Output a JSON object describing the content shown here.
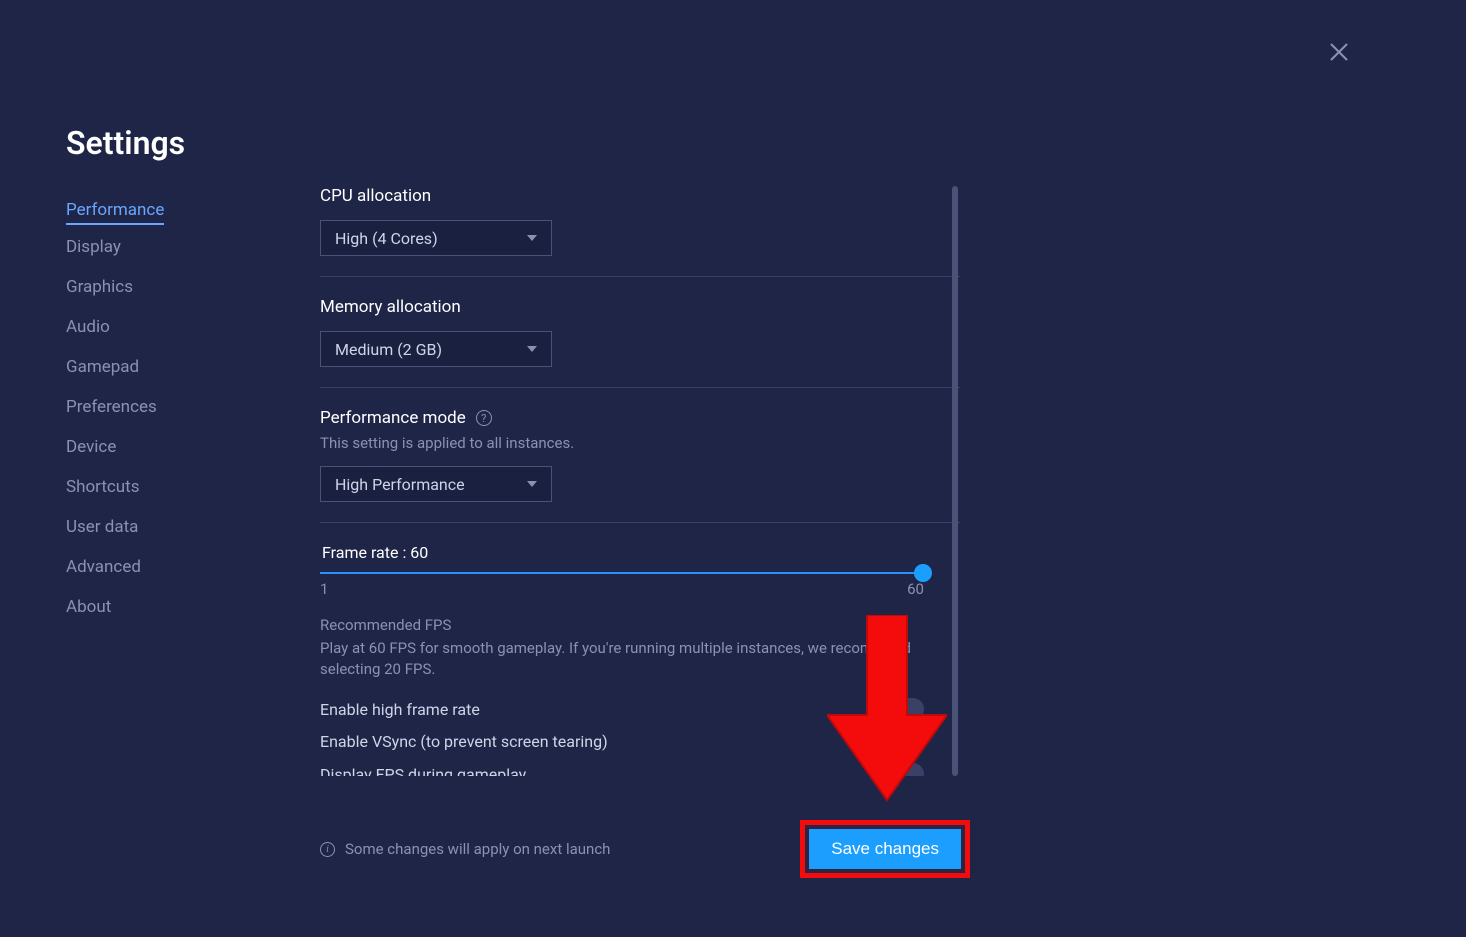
{
  "title": "Settings",
  "sidebar": {
    "items": [
      {
        "label": "Performance",
        "active": true
      },
      {
        "label": "Display"
      },
      {
        "label": "Graphics"
      },
      {
        "label": "Audio"
      },
      {
        "label": "Gamepad"
      },
      {
        "label": "Preferences"
      },
      {
        "label": "Device"
      },
      {
        "label": "Shortcuts"
      },
      {
        "label": "User data"
      },
      {
        "label": "Advanced"
      },
      {
        "label": "About"
      }
    ]
  },
  "sections": {
    "cpu": {
      "label": "CPU allocation",
      "value": "High (4 Cores)"
    },
    "memory": {
      "label": "Memory allocation",
      "value": "Medium (2 GB)"
    },
    "performance_mode": {
      "label": "Performance mode",
      "sublabel": "This setting is applied to all instances.",
      "value": "High Performance"
    },
    "frame_rate": {
      "label": "Frame rate : 60",
      "min": "1",
      "max": "60",
      "value": 60,
      "recommended_title": "Recommended FPS",
      "recommended_text": "Play at 60 FPS for smooth gameplay. If you're running multiple instances, we recommend selecting 20 FPS."
    },
    "toggles": {
      "high_fps": "Enable high frame rate",
      "vsync": "Enable VSync (to prevent screen tearing)",
      "display_fps": "Display FPS during gameplay"
    }
  },
  "footer": {
    "info_text": "Some changes will apply on next launch",
    "save_label": "Save changes"
  }
}
